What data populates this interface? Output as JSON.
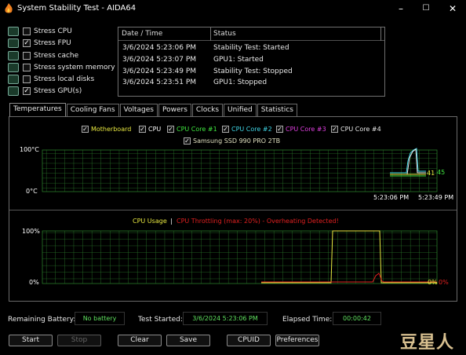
{
  "window": {
    "title": "System Stability Test - AIDA64",
    "controls": [
      "–",
      "☐",
      "✕"
    ]
  },
  "stress_options": [
    {
      "label": "Stress CPU",
      "checked": false,
      "icon": "cpu-icon"
    },
    {
      "label": "Stress FPU",
      "checked": true,
      "icon": "fpu-icon"
    },
    {
      "label": "Stress cache",
      "checked": false,
      "icon": "cache-icon"
    },
    {
      "label": "Stress system memory",
      "checked": false,
      "icon": "memory-icon"
    },
    {
      "label": "Stress local disks",
      "checked": false,
      "icon": "disk-icon"
    },
    {
      "label": "Stress GPU(s)",
      "checked": true,
      "icon": "gpu-icon"
    }
  ],
  "log": {
    "headers": [
      "Date / Time",
      "Status"
    ],
    "rows": [
      {
        "time": "3/6/2024 5:23:06 PM",
        "status": "Stability Test: Started"
      },
      {
        "time": "3/6/2024 5:23:07 PM",
        "status": "GPU1: Started"
      },
      {
        "time": "3/6/2024 5:23:49 PM",
        "status": "Stability Test: Stopped"
      },
      {
        "time": "3/6/2024 5:23:51 PM",
        "status": "GPU1: Stopped"
      }
    ]
  },
  "tabs": [
    "Temperatures",
    "Cooling Fans",
    "Voltages",
    "Powers",
    "Clocks",
    "Unified",
    "Statistics"
  ],
  "active_tab": "Temperatures",
  "legend": [
    {
      "label": "Motherboard",
      "color": "#e8e840",
      "checked": true
    },
    {
      "label": "CPU",
      "color": "#ffffff",
      "checked": true
    },
    {
      "label": "CPU Core #1",
      "color": "#40e840",
      "checked": true
    },
    {
      "label": "CPU Core #2",
      "color": "#40d8e8",
      "checked": true
    },
    {
      "label": "CPU Core #3",
      "color": "#e040e0",
      "checked": true
    },
    {
      "label": "CPU Core #4",
      "color": "#e8e8e8",
      "checked": true
    },
    {
      "label": "Samsung SSD 990 PRO 2TB",
      "color": "#e0e0c0",
      "checked": true
    }
  ],
  "temp_graph": {
    "y_max_label": "100°C",
    "y_min_label": "0°C",
    "time_labels": [
      "5:23:06 PM",
      "5:23:49 PM"
    ],
    "value_labels": [
      "41",
      "45"
    ]
  },
  "cpu_graph": {
    "title_usage": "CPU Usage",
    "title_sep": "|",
    "title_throttle": "CPU Throttling (max: 20%) - Overheating Detected!",
    "y_max_label": "100%",
    "y_min_label": "0%",
    "value_labels": [
      "0%",
      "0%"
    ],
    "usage_color": "#e8e840",
    "throttle_color": "#e02020"
  },
  "status_bar": {
    "battery_label": "Remaining Battery:",
    "battery_value": "No battery",
    "started_label": "Test Started:",
    "started_value": "3/6/2024 5:23:06 PM",
    "elapsed_label": "Elapsed Time:",
    "elapsed_value": "00:00:42"
  },
  "buttons": {
    "start": "Start",
    "stop": "Stop",
    "clear": "Clear",
    "save": "Save",
    "cpuid": "CPUID",
    "preferences": "Preferences"
  },
  "watermark": "豆星人"
}
